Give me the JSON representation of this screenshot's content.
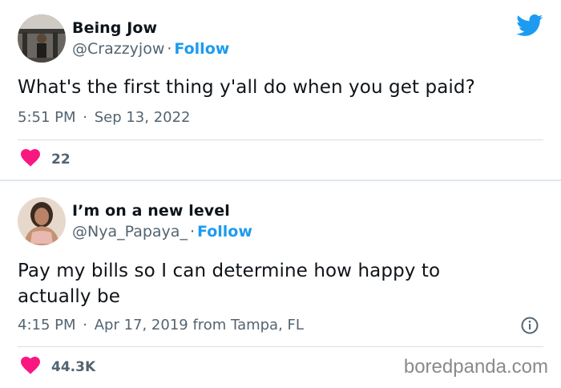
{
  "tweet1": {
    "name": "Being Jow",
    "handle": "@Crazzyjow",
    "follow": "Follow",
    "text": "What's the first thing y'all do when you get paid?",
    "time": "5:51 PM",
    "date": "Sep 13, 2022",
    "likes": "22",
    "icons": {
      "brand": "twitter-bird-icon",
      "like": "heart-icon"
    }
  },
  "tweet2": {
    "name": "I’m on a new level",
    "handle": "@Nya_Papaya_",
    "follow": "Follow",
    "text": "Pay my bills so I can determine how happy to actually be",
    "time": "4:15 PM",
    "date_location": "Apr 17, 2019 from Tampa, FL",
    "likes": "44.3K",
    "icons": {
      "info": "info-icon",
      "like": "heart-icon"
    }
  },
  "watermark": "boredpanda.com",
  "colors": {
    "accent": "#1d9bf0",
    "heart": "#f91880",
    "muted": "#536471"
  }
}
